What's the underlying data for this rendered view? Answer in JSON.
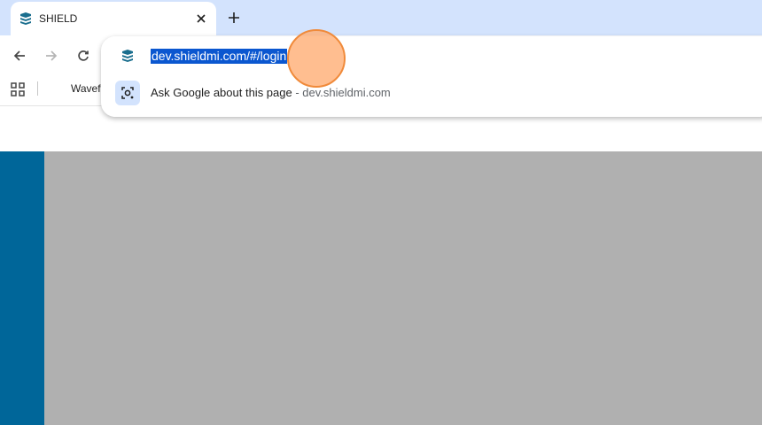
{
  "tab": {
    "title": "SHIELD"
  },
  "bookmarks": {
    "item_1": "Wavefr"
  },
  "omnibox": {
    "url": "dev.shieldmi.com/#/login",
    "suggestion_text": "Ask Google about this page",
    "suggestion_separator": " - ",
    "suggestion_domain": "dev.shieldmi.com"
  },
  "colors": {
    "tabstrip": "#d3e3fd",
    "selection": "#0b57d0",
    "sidebar": "#006699",
    "page_main": "#b0b0b0",
    "click_indicator": "#f08a3a"
  },
  "icons": {
    "favicon": "shield-layers-icon",
    "close": "close-icon",
    "new_tab": "plus-icon",
    "back": "arrow-left-icon",
    "forward": "arrow-right-icon",
    "reload": "reload-icon",
    "apps": "apps-grid-icon",
    "lens": "google-lens-icon"
  }
}
